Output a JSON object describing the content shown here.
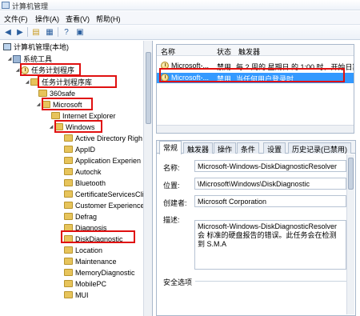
{
  "window": {
    "title": "计算机管理"
  },
  "menu": [
    {
      "label": "文件(F)"
    },
    {
      "label": "操作(A)"
    },
    {
      "label": "查看(V)"
    },
    {
      "label": "帮助(H)"
    }
  ],
  "toolbar": {
    "back_icon": "arrow-left-icon",
    "forward_icon": "arrow-right-icon",
    "up_icon": "folder-up-icon",
    "show_tree_icon": "console-tree-icon",
    "help_icon": "help-icon",
    "properties_icon": "properties-icon"
  },
  "tree": {
    "nodes": [
      {
        "label": "计算机管理(本地)"
      },
      {
        "label": "系统工具"
      },
      {
        "label": "任务计划程序"
      },
      {
        "label": "任务计划程序库"
      },
      {
        "label": "360safe"
      },
      {
        "label": "Microsoft"
      },
      {
        "label": "Internet Explorer"
      },
      {
        "label": "Windows"
      },
      {
        "label": "Active Directory Righ"
      },
      {
        "label": "AppID"
      },
      {
        "label": "Application Experien"
      },
      {
        "label": "Autochk"
      },
      {
        "label": "Bluetooth"
      },
      {
        "label": "CertificateServicesCli"
      },
      {
        "label": "Customer Experience"
      },
      {
        "label": "Defrag"
      },
      {
        "label": "Diagnosis"
      },
      {
        "label": "DiskDiagnostic"
      },
      {
        "label": "Location"
      },
      {
        "label": "Maintenance"
      },
      {
        "label": "MemoryDiagnostic"
      },
      {
        "label": "MobilePC"
      },
      {
        "label": "MUI"
      }
    ]
  },
  "task_list": {
    "columns": [
      "名称",
      "状态",
      "触发器"
    ],
    "rows": [
      {
        "name": "Microsoft-...",
        "status": "禁用",
        "trigger": "每 2 周的 星期日 的 1:00 时，开始日期"
      },
      {
        "name": "Microsoft-...",
        "status": "禁用",
        "trigger": "当任何用户登录时"
      }
    ]
  },
  "detail": {
    "tabs": [
      "常规",
      "触发器",
      "操作",
      "条件",
      "设置",
      "历史记录(已禁用)"
    ],
    "fields": {
      "name_label": "名称:",
      "name_value": "Microsoft-Windows-DiskDiagnosticResolver",
      "location_label": "位置:",
      "location_value": "\\Microsoft\\Windows\\DiskDiagnostic",
      "author_label": "创建者:",
      "author_value": "Microsoft Corporation",
      "description_label": "描述:",
      "description_value": "Microsoft-Windows-DiskDiagnosticResolver 会 标准的硬盘报告的错误。此任务会在检测到 S.M.A"
    },
    "security_section": "安全选项"
  },
  "colors": {
    "highlight": "#e01010",
    "selection": "#3399ff"
  }
}
